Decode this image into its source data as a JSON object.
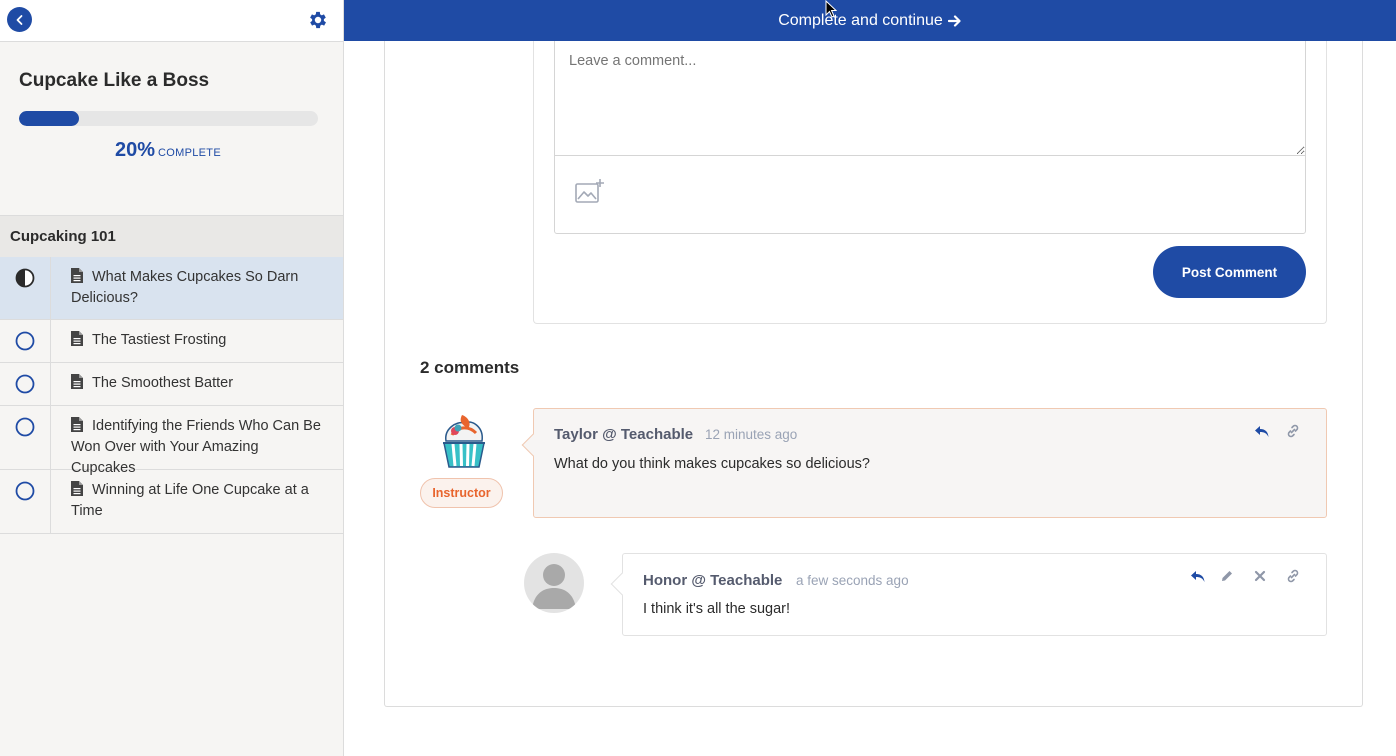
{
  "sidebar": {
    "course_title": "Cupcake Like a Boss",
    "progress": {
      "percent_value": 20,
      "percent_label": "20%",
      "complete_label": "COMPLETE"
    },
    "section_title": "Cupcaking 101",
    "lectures": [
      {
        "title": "What Makes Cupcakes So Darn Delicious?",
        "status": "in-progress",
        "active": true
      },
      {
        "title": "The Tastiest Frosting",
        "status": "not-started"
      },
      {
        "title": "The Smoothest Batter",
        "status": "not-started"
      },
      {
        "title": "Identifying the Friends Who Can Be Won Over with Your Amazing Cupcakes",
        "status": "not-started"
      },
      {
        "title": "Winning at Life One Cupcake at a Time",
        "status": "not-started"
      }
    ]
  },
  "topbar": {
    "label": "Complete and continue"
  },
  "comment_form": {
    "placeholder": "Leave a comment...",
    "post_label": "Post Comment"
  },
  "comments": {
    "count_label": "2 comments",
    "items": [
      {
        "author": "Taylor @ Teachable",
        "time": "12 minutes ago",
        "text": "What do you think makes cupcakes so delicious?",
        "badge": "Instructor"
      },
      {
        "author": "Honor @ Teachable",
        "time": "a few seconds ago",
        "text": "I think it's all the sugar!"
      }
    ]
  },
  "colors": {
    "primary": "#1f4ba5",
    "instructor": "#e8652e",
    "active_lecture_bg": "#d9e3ef"
  }
}
